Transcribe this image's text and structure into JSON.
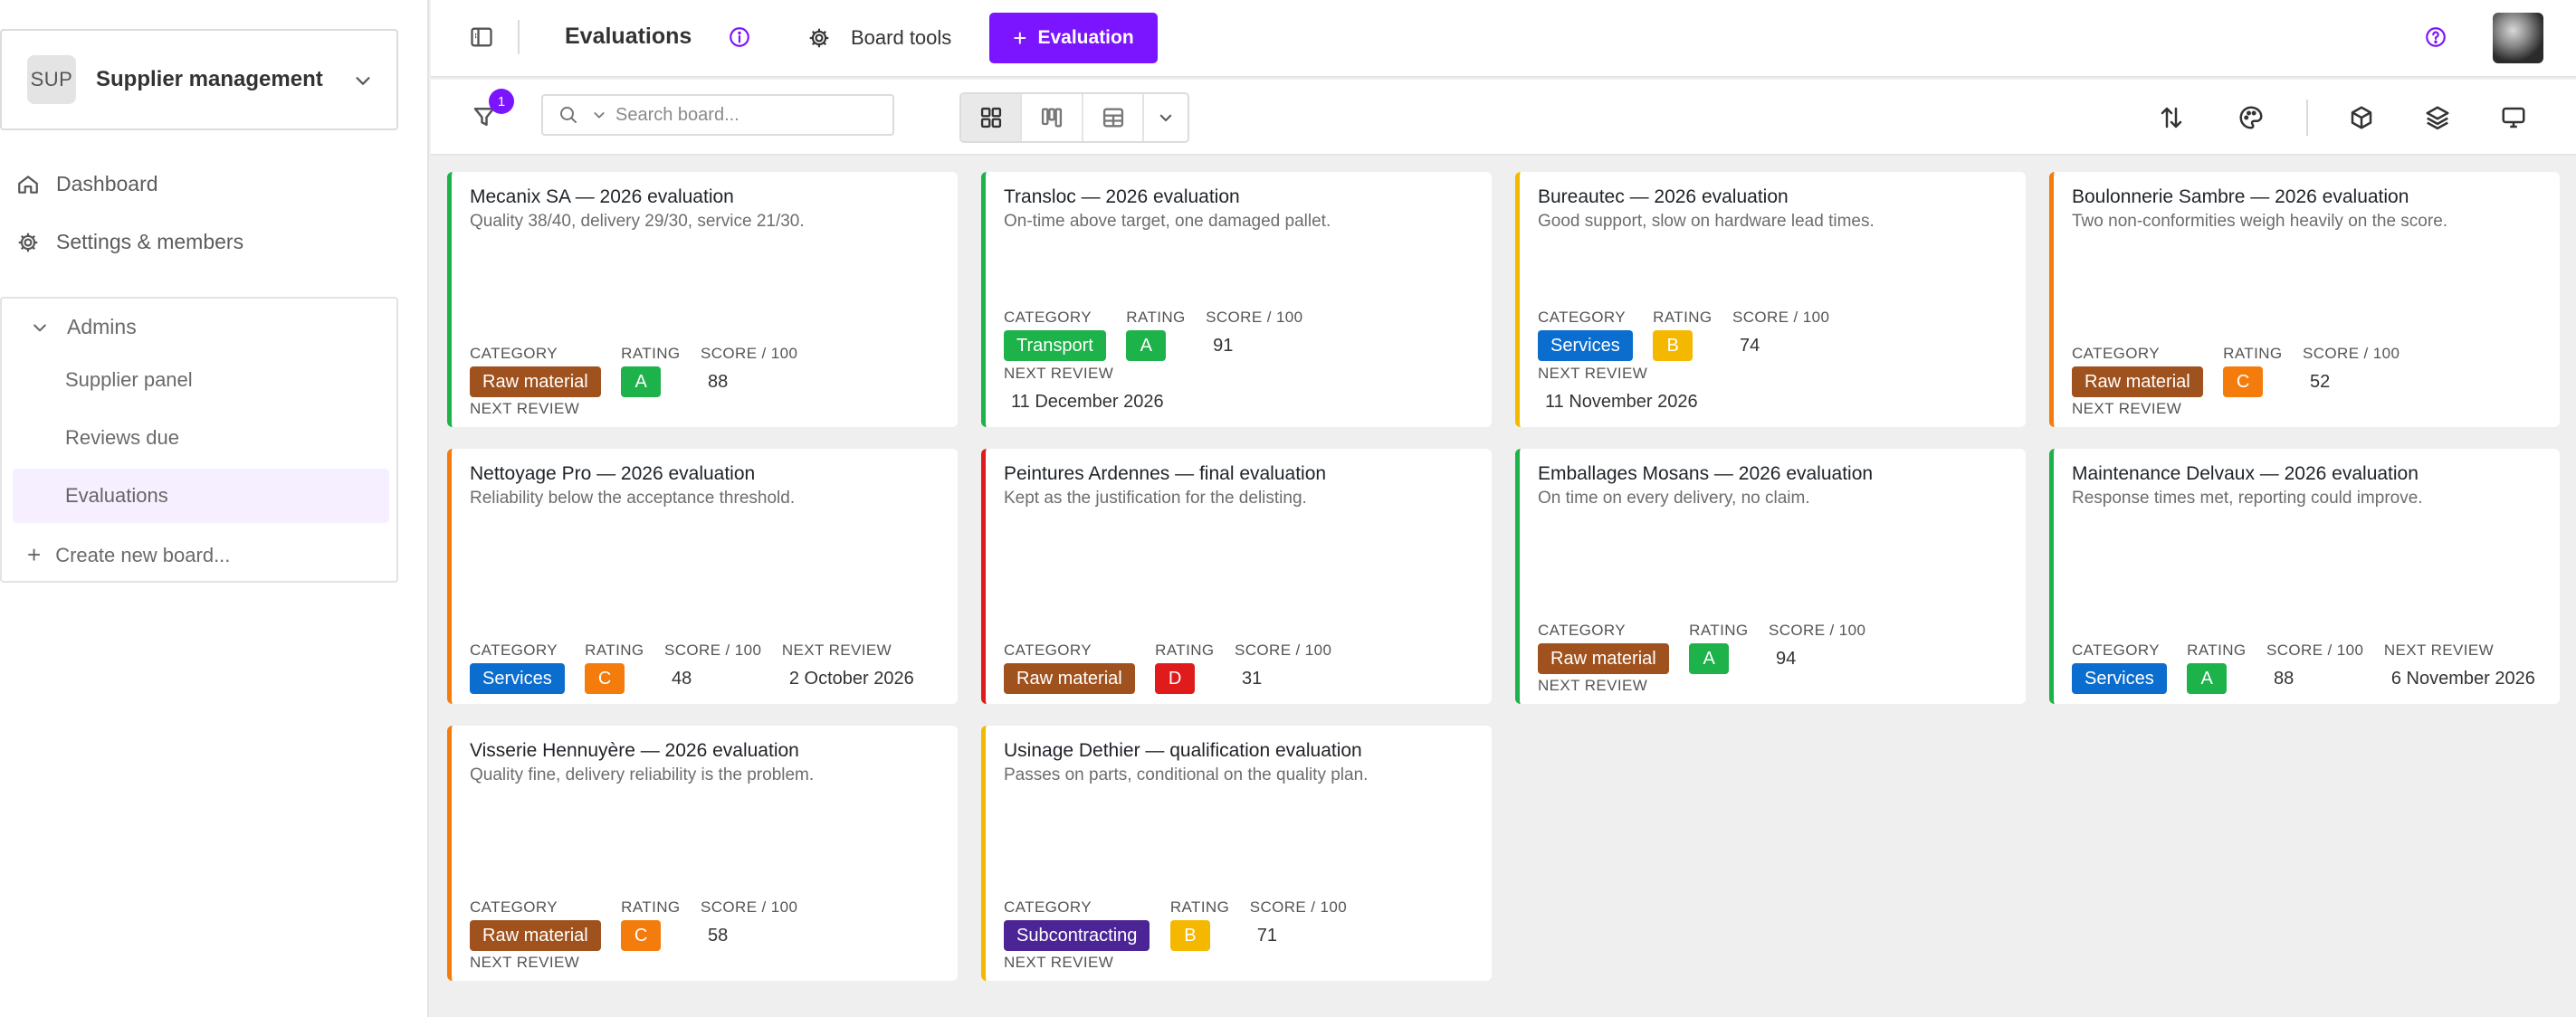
{
  "workspace": {
    "badge": "SUP",
    "name": "Supplier management"
  },
  "nav": {
    "dashboard": "Dashboard",
    "settings": "Settings & members"
  },
  "sidebar_group": {
    "label": "Admins",
    "items": [
      "Supplier panel",
      "Reviews due",
      "Evaluations"
    ],
    "active": "Evaluations",
    "create": "Create new board..."
  },
  "header": {
    "title": "Evaluations",
    "board_tools": "Board tools",
    "new_button": "Evaluation"
  },
  "toolbar": {
    "filter_count": "1",
    "search_placeholder": "Search board..."
  },
  "colors": {
    "accent": "#7b14ff",
    "good": "#1db24a",
    "warn": "#f5b800",
    "orange": "#f47c0c",
    "bad": "#e01b1b",
    "cat_raw_material": "#a0521e",
    "cat_transport": "#1db24a",
    "cat_services": "#0b6dce",
    "cat_subcontracting": "#4b2596"
  },
  "labels": {
    "category": "CATEGORY",
    "rating": "RATING",
    "score": "SCORE / 100",
    "next_review": "NEXT REVIEW"
  },
  "cards": [
    {
      "title": "Mecanix SA — 2026 evaluation",
      "description": "Quality 38/40, delivery 29/30, service 21/30.",
      "category": "Raw material",
      "rating": "A",
      "score": "88",
      "next_review": ""
    },
    {
      "title": "Transloc — 2026 evaluation",
      "description": "On-time above target, one damaged pallet.",
      "category": "Transport",
      "rating": "A",
      "score": "91",
      "next_review": "11 December 2026"
    },
    {
      "title": "Bureautec — 2026 evaluation",
      "description": "Good support, slow on hardware lead times.",
      "category": "Services",
      "rating": "B",
      "score": "74",
      "next_review": "11 November 2026"
    },
    {
      "title": "Boulonnerie Sambre — 2026 evaluation",
      "description": "Two non-conformities weigh heavily on the score.",
      "category": "Raw material",
      "rating": "C",
      "score": "52",
      "next_review": ""
    },
    {
      "title": "Nettoyage Pro — 2026 evaluation",
      "description": "Reliability below the acceptance threshold.",
      "category": "Services",
      "rating": "C",
      "score": "48",
      "next_review": "2 October 2026"
    },
    {
      "title": "Peintures Ardennes — final evaluation",
      "description": "Kept as the justification for the delisting.",
      "category": "Raw material",
      "rating": "D",
      "score": "31",
      "next_review": ""
    },
    {
      "title": "Emballages Mosans — 2026 evaluation",
      "description": "On time on every delivery, no claim.",
      "category": "Raw material",
      "rating": "A",
      "score": "94",
      "next_review": ""
    },
    {
      "title": "Maintenance Delvaux — 2026 evaluation",
      "description": "Response times met, reporting could improve.",
      "category": "Services",
      "rating": "A",
      "score": "88",
      "next_review": "6 November 2026"
    },
    {
      "title": "Visserie Hennuyère — 2026 evaluation",
      "description": "Quality fine, delivery reliability is the problem.",
      "category": "Raw material",
      "rating": "C",
      "score": "58",
      "next_review": ""
    },
    {
      "title": "Usinage Dethier — qualification evaluation",
      "description": "Passes on parts, conditional on the quality plan.",
      "category": "Subcontracting",
      "rating": "B",
      "score": "71",
      "next_review": ""
    }
  ]
}
